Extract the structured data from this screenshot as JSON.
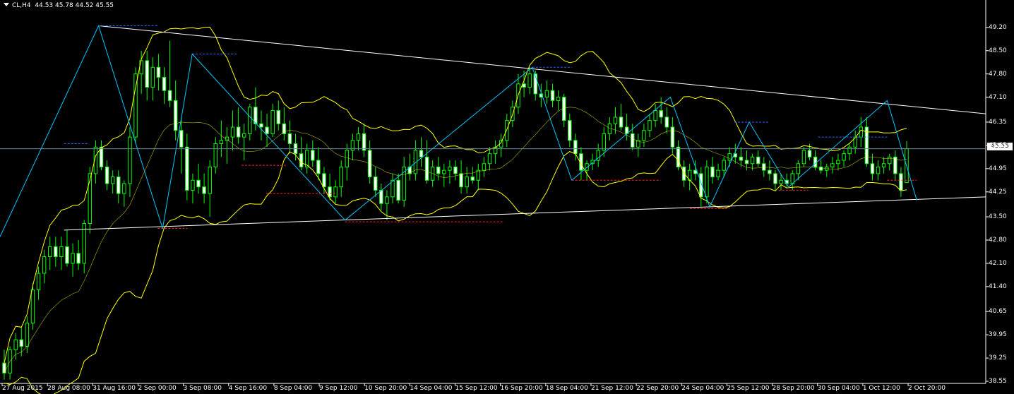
{
  "title": {
    "symbol_tf": "CL,H4",
    "ohlc": "44.53 45.78 44.52 45.55",
    "collapse_icon": "triangle-down-icon"
  },
  "colors": {
    "background": "#000000",
    "axis": "#ffffff",
    "candle_up": "#00ff00",
    "candle_down_fill": "#ffffff",
    "bollinger": "#ffff00",
    "zigzag": "#00c8ff",
    "trendline": "#ffffff",
    "support_marks": "#ff2020",
    "resistance_marks": "#3060ff"
  },
  "price_tag": "45.55",
  "chart_data": {
    "type": "candlestick",
    "symbol": "CL",
    "timeframe": "H4",
    "ylim": [
      38.55,
      49.6
    ],
    "y_ticks": [
      "49.20",
      "48.50",
      "47.80",
      "47.10",
      "46.35",
      "45.65",
      "44.95",
      "44.25",
      "43.50",
      "42.80",
      "42.10",
      "41.40",
      "40.65",
      "39.95",
      "39.25",
      "38.55"
    ],
    "x_ticks": [
      "27 Aug 2015",
      "28 Aug 08:00",
      "31 Aug 16:00",
      "2 Sep 00:00",
      "3 Sep 08:00",
      "4 Sep 16:00",
      "8 Sep 04:00",
      "9 Sep 12:00",
      "10 Sep 20:00",
      "14 Sep 04:00",
      "15 Sep 12:00",
      "16 Sep 20:00",
      "18 Sep 04:00",
      "21 Sep 12:00",
      "22 Sep 20:00",
      "24 Sep 04:00",
      "25 Sep 12:00",
      "28 Sep 20:00",
      "30 Sep 04:00",
      "1 Oct 12:00",
      "2 Oct 20:00"
    ],
    "last_price": 45.55,
    "candles": [
      [
        39.1,
        39.5,
        38.6,
        38.8
      ],
      [
        38.8,
        39.6,
        38.6,
        39.5
      ],
      [
        39.5,
        40.0,
        39.2,
        39.8
      ],
      [
        39.8,
        40.2,
        39.3,
        39.6
      ],
      [
        39.6,
        40.5,
        39.4,
        40.3
      ],
      [
        40.3,
        41.5,
        40.1,
        41.3
      ],
      [
        41.3,
        42.0,
        41.0,
        41.8
      ],
      [
        41.8,
        42.5,
        41.5,
        42.3
      ],
      [
        42.3,
        42.9,
        41.9,
        42.6
      ],
      [
        42.6,
        42.9,
        42.0,
        42.3
      ],
      [
        42.3,
        42.9,
        41.9,
        42.6
      ],
      [
        42.6,
        43.1,
        42.0,
        42.1
      ],
      [
        42.1,
        42.7,
        41.7,
        42.4
      ],
      [
        42.4,
        42.8,
        41.9,
        42.1
      ],
      [
        42.1,
        43.4,
        41.8,
        43.3
      ],
      [
        43.3,
        45.0,
        43.0,
        44.8
      ],
      [
        44.8,
        45.8,
        44.5,
        45.6
      ],
      [
        45.6,
        45.8,
        44.9,
        45.0
      ],
      [
        45.0,
        45.2,
        44.3,
        44.5
      ],
      [
        44.5,
        44.9,
        44.2,
        44.7
      ],
      [
        44.7,
        44.9,
        43.9,
        44.2
      ],
      [
        44.2,
        44.6,
        43.8,
        44.5
      ],
      [
        44.5,
        46.2,
        44.1,
        45.9
      ],
      [
        45.9,
        48.0,
        45.7,
        47.8
      ],
      [
        47.8,
        48.5,
        47.2,
        48.2
      ],
      [
        48.2,
        48.5,
        47.0,
        47.4
      ],
      [
        47.4,
        48.3,
        47.0,
        48.0
      ],
      [
        48.0,
        48.4,
        47.3,
        47.7
      ],
      [
        47.7,
        48.0,
        46.9,
        47.3
      ],
      [
        47.3,
        48.8,
        46.8,
        47.0
      ],
      [
        47.0,
        47.6,
        45.8,
        46.1
      ],
      [
        46.1,
        46.5,
        44.8,
        45.6
      ],
      [
        45.6,
        46.0,
        44.0,
        44.3
      ],
      [
        44.3,
        44.8,
        43.9,
        44.6
      ],
      [
        44.6,
        45.1,
        44.2,
        44.4
      ],
      [
        44.4,
        44.8,
        43.9,
        44.2
      ],
      [
        44.2,
        45.2,
        43.5,
        45.0
      ],
      [
        45.0,
        45.9,
        44.8,
        45.7
      ],
      [
        45.7,
        46.4,
        45.3,
        45.8
      ],
      [
        45.8,
        46.2,
        45.1,
        45.9
      ],
      [
        45.9,
        46.7,
        45.5,
        46.2
      ],
      [
        46.2,
        46.8,
        45.7,
        45.9
      ],
      [
        45.9,
        46.3,
        45.2,
        46.0
      ],
      [
        46.0,
        46.9,
        45.8,
        46.8
      ],
      [
        46.8,
        47.4,
        46.1,
        46.3
      ],
      [
        46.3,
        46.7,
        45.8,
        46.2
      ],
      [
        46.2,
        46.6,
        45.6,
        46.0
      ],
      [
        46.0,
        46.9,
        45.9,
        46.7
      ],
      [
        46.7,
        47.0,
        46.1,
        46.3
      ],
      [
        46.3,
        46.8,
        45.8,
        46.0
      ],
      [
        46.0,
        46.4,
        45.4,
        45.7
      ],
      [
        45.7,
        46.0,
        45.2,
        45.4
      ],
      [
        45.4,
        45.9,
        44.9,
        45.0
      ],
      [
        45.0,
        45.7,
        44.8,
        45.5
      ],
      [
        45.5,
        45.8,
        45.0,
        45.2
      ],
      [
        45.2,
        45.6,
        44.6,
        44.8
      ],
      [
        44.8,
        45.0,
        44.2,
        44.4
      ],
      [
        44.4,
        44.8,
        44.0,
        44.1
      ],
      [
        44.1,
        44.6,
        43.9,
        44.4
      ],
      [
        44.4,
        45.2,
        44.1,
        45.0
      ],
      [
        45.0,
        45.7,
        44.6,
        45.5
      ],
      [
        45.5,
        46.0,
        45.2,
        45.8
      ],
      [
        45.8,
        46.2,
        45.5,
        46.0
      ],
      [
        46.0,
        46.3,
        45.3,
        45.5
      ],
      [
        45.5,
        45.8,
        44.5,
        44.7
      ],
      [
        44.7,
        45.0,
        44.1,
        44.3
      ],
      [
        44.3,
        44.5,
        43.7,
        43.9
      ],
      [
        43.9,
        44.3,
        43.4,
        44.1
      ],
      [
        44.1,
        44.8,
        43.9,
        44.6
      ],
      [
        44.6,
        44.8,
        43.9,
        44.0
      ],
      [
        44.0,
        45.3,
        43.8,
        45.0
      ],
      [
        45.0,
        45.4,
        44.6,
        44.8
      ],
      [
        44.8,
        45.8,
        44.6,
        45.5
      ],
      [
        45.5,
        45.9,
        45.0,
        45.3
      ],
      [
        45.3,
        45.8,
        44.5,
        44.6
      ],
      [
        44.6,
        45.2,
        44.4,
        45.0
      ],
      [
        45.0,
        45.3,
        44.6,
        44.8
      ],
      [
        44.8,
        45.1,
        44.4,
        44.9
      ],
      [
        44.9,
        45.2,
        44.5,
        45.0
      ],
      [
        45.0,
        45.2,
        44.6,
        44.8
      ],
      [
        44.8,
        45.2,
        44.2,
        44.4
      ],
      [
        44.4,
        45.0,
        44.2,
        44.7
      ],
      [
        44.7,
        45.0,
        44.5,
        44.6
      ],
      [
        44.6,
        45.1,
        44.3,
        44.9
      ],
      [
        44.9,
        45.3,
        44.7,
        45.1
      ],
      [
        45.1,
        45.6,
        44.9,
        45.4
      ],
      [
        45.4,
        45.8,
        45.1,
        45.6
      ],
      [
        45.6,
        46.0,
        45.3,
        45.8
      ],
      [
        45.8,
        46.6,
        45.6,
        46.4
      ],
      [
        46.4,
        47.0,
        46.2,
        46.8
      ],
      [
        46.8,
        47.8,
        46.6,
        47.5
      ],
      [
        47.5,
        47.9,
        47.1,
        47.4
      ],
      [
        47.4,
        48.0,
        47.2,
        47.8
      ],
      [
        47.8,
        47.9,
        47.0,
        47.2
      ],
      [
        47.2,
        47.5,
        46.8,
        47.1
      ],
      [
        47.1,
        47.6,
        46.9,
        47.3
      ],
      [
        47.3,
        47.5,
        46.8,
        47.0
      ],
      [
        47.0,
        47.3,
        46.7,
        47.1
      ],
      [
        47.1,
        47.2,
        46.2,
        46.4
      ],
      [
        46.4,
        46.6,
        45.6,
        45.8
      ],
      [
        45.8,
        46.0,
        45.2,
        45.4
      ],
      [
        45.4,
        45.6,
        44.6,
        44.9
      ],
      [
        44.9,
        45.2,
        44.6,
        45.1
      ],
      [
        45.1,
        45.4,
        44.9,
        45.2
      ],
      [
        45.2,
        45.7,
        45.0,
        45.5
      ],
      [
        45.5,
        46.2,
        45.3,
        46.0
      ],
      [
        46.0,
        46.5,
        45.8,
        46.3
      ],
      [
        46.3,
        46.8,
        46.0,
        46.5
      ],
      [
        46.5,
        46.9,
        46.1,
        46.2
      ],
      [
        46.2,
        46.6,
        45.8,
        46.0
      ],
      [
        46.0,
        46.3,
        45.5,
        45.6
      ],
      [
        45.6,
        46.0,
        45.3,
        45.8
      ],
      [
        45.8,
        46.3,
        45.6,
        46.1
      ],
      [
        46.1,
        46.6,
        45.9,
        46.4
      ],
      [
        46.4,
        46.9,
        46.2,
        46.7
      ],
      [
        46.7,
        47.1,
        46.3,
        46.5
      ],
      [
        46.5,
        46.8,
        46.0,
        46.2
      ],
      [
        46.2,
        46.5,
        45.4,
        45.6
      ],
      [
        45.6,
        45.8,
        44.9,
        45.0
      ],
      [
        45.0,
        45.2,
        44.4,
        44.6
      ],
      [
        44.6,
        45.1,
        44.3,
        44.9
      ],
      [
        44.9,
        45.2,
        44.6,
        44.8
      ],
      [
        44.8,
        45.0,
        43.8,
        44.1
      ],
      [
        44.1,
        45.2,
        43.9,
        45.0
      ],
      [
        45.0,
        45.3,
        44.5,
        44.7
      ],
      [
        44.7,
        45.1,
        44.6,
        44.9
      ],
      [
        44.9,
        45.3,
        44.7,
        45.2
      ],
      [
        45.2,
        45.6,
        45.0,
        45.4
      ],
      [
        45.4,
        45.7,
        45.1,
        45.3
      ],
      [
        45.3,
        45.6,
        45.0,
        45.2
      ],
      [
        45.2,
        45.5,
        44.9,
        45.1
      ],
      [
        45.1,
        45.4,
        44.9,
        45.3
      ],
      [
        45.3,
        45.5,
        45.0,
        45.1
      ],
      [
        45.1,
        45.3,
        44.7,
        44.9
      ],
      [
        44.9,
        45.2,
        44.6,
        44.8
      ],
      [
        44.8,
        44.9,
        44.3,
        44.5
      ],
      [
        44.5,
        44.8,
        44.3,
        44.6
      ],
      [
        44.6,
        44.8,
        44.4,
        44.5
      ],
      [
        44.5,
        44.9,
        44.3,
        44.8
      ],
      [
        44.8,
        45.2,
        44.6,
        45.1
      ],
      [
        45.1,
        45.6,
        45.0,
        45.5
      ],
      [
        45.5,
        45.7,
        45.2,
        45.3
      ],
      [
        45.3,
        45.5,
        44.9,
        45.0
      ],
      [
        45.0,
        45.2,
        44.8,
        44.9
      ],
      [
        44.9,
        45.1,
        44.7,
        45.0
      ],
      [
        45.0,
        45.3,
        44.8,
        45.1
      ],
      [
        45.1,
        45.4,
        44.9,
        45.2
      ],
      [
        45.2,
        45.5,
        45.0,
        45.4
      ],
      [
        45.4,
        45.7,
        45.2,
        45.6
      ],
      [
        45.6,
        46.1,
        45.4,
        45.9
      ],
      [
        45.9,
        46.5,
        45.6,
        46.2
      ],
      [
        46.2,
        46.5,
        45.0,
        45.1
      ],
      [
        45.1,
        45.4,
        44.6,
        44.8
      ],
      [
        44.8,
        45.2,
        44.6,
        45.0
      ],
      [
        45.0,
        45.3,
        44.8,
        45.1
      ],
      [
        45.1,
        45.4,
        44.9,
        45.3
      ],
      [
        45.3,
        45.5,
        44.6,
        44.8
      ],
      [
        44.8,
        45.0,
        44.1,
        44.3
      ],
      [
        44.53,
        45.78,
        44.52,
        45.55
      ]
    ],
    "overlays": {
      "trendline_upper": [
        [
          0.1,
          49.25
        ],
        [
          1.0,
          46.6
        ]
      ],
      "trendline_lower": [
        [
          0.065,
          43.1
        ],
        [
          1.0,
          44.1
        ]
      ],
      "zigzag": [
        [
          0,
          42.9
        ],
        [
          0.1,
          49.25
        ],
        [
          0.165,
          43.15
        ],
        [
          0.195,
          48.4
        ],
        [
          0.35,
          43.4
        ],
        [
          0.54,
          48.0
        ],
        [
          0.58,
          44.6
        ],
        [
          0.68,
          47.1
        ],
        [
          0.72,
          43.8
        ],
        [
          0.76,
          46.35
        ],
        [
          0.8,
          44.4
        ],
        [
          0.9,
          47.0
        ],
        [
          0.93,
          44.0
        ]
      ],
      "support_marks": [
        [
          0.16,
          0.19,
          43.15
        ],
        [
          0.245,
          0.29,
          45.05
        ],
        [
          0.27,
          0.34,
          44.2
        ],
        [
          0.35,
          0.51,
          43.35
        ],
        [
          0.58,
          0.67,
          44.6
        ],
        [
          0.7,
          0.74,
          43.75
        ],
        [
          0.79,
          0.82,
          44.3
        ],
        [
          0.9,
          0.93,
          44.6
        ]
      ],
      "resistance_marks": [
        [
          0.065,
          0.09,
          45.7
        ],
        [
          0.1,
          0.16,
          49.25
        ],
        [
          0.195,
          0.24,
          48.4
        ],
        [
          0.54,
          0.58,
          48.0
        ],
        [
          0.745,
          0.78,
          46.35
        ],
        [
          0.83,
          0.9,
          45.9
        ]
      ]
    }
  }
}
